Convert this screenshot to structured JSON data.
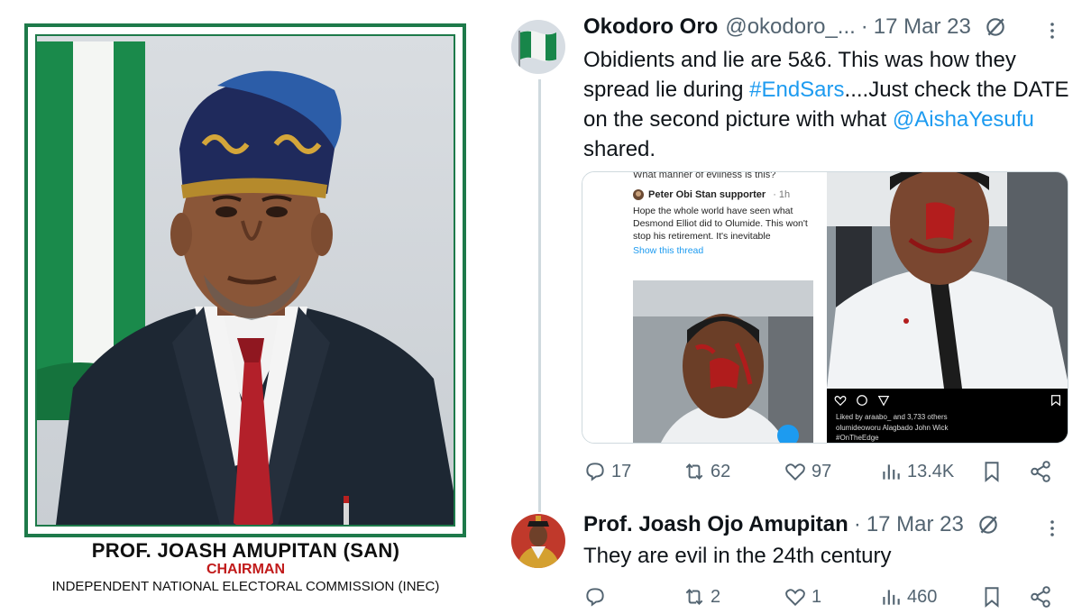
{
  "poster": {
    "name": "PROF. JOASH AMUPITAN (SAN)",
    "role": "CHAIRMAN",
    "organization": "INDEPENDENT NATIONAL ELECTORAL COMMISSION (INEC)"
  },
  "tweets": [
    {
      "display_name": "Okodoro Oro",
      "handle": "@okodoro_...",
      "separator": "·",
      "date": "17 Mar 23",
      "text_parts": {
        "a": "Obidients and lie are 5&6. This was how they spread lie during ",
        "b": "#EndSars",
        "c": "....Just check the DATE on the second picture with what ",
        "d": "@AishaYesufu",
        "e": " shared."
      },
      "media": {
        "left": {
          "top_text": "What manner of evilness is this?",
          "author": "Peter Obi Stan supporter",
          "ago": "· 1h",
          "body": "Hope the whole world have seen what Desmond Elliot did to Olumide. This won't stop his retirement. It's inevitable",
          "show_thread": "Show this thread"
        },
        "right": {
          "likes": "Liked by araabo_ and 3,733 others",
          "caption": "olumideoworu Alagbado John Wick",
          "hashtag": "#OnTheEdge"
        }
      },
      "actions": {
        "replies": "17",
        "retweets": "62",
        "likes": "97",
        "views": "13.4K"
      }
    },
    {
      "display_name": "Prof. Joash Ojo Amupitan",
      "separator": "·",
      "date": "17 Mar 23",
      "text": "They are evil in the 24th century",
      "actions": {
        "replies": "",
        "retweets": "2",
        "likes": "1",
        "views": "460"
      }
    }
  ],
  "colors": {
    "accent_link": "#1d9bf0",
    "muted": "#536471",
    "poster_green": "#1e7a4a",
    "poster_red": "#c11b1b"
  },
  "icons": [
    "flag-avatar-icon",
    "edit-history-icon",
    "more-dots-icon",
    "reply-icon",
    "retweet-icon",
    "like-icon",
    "views-icon",
    "bookmark-icon",
    "share-icon"
  ]
}
